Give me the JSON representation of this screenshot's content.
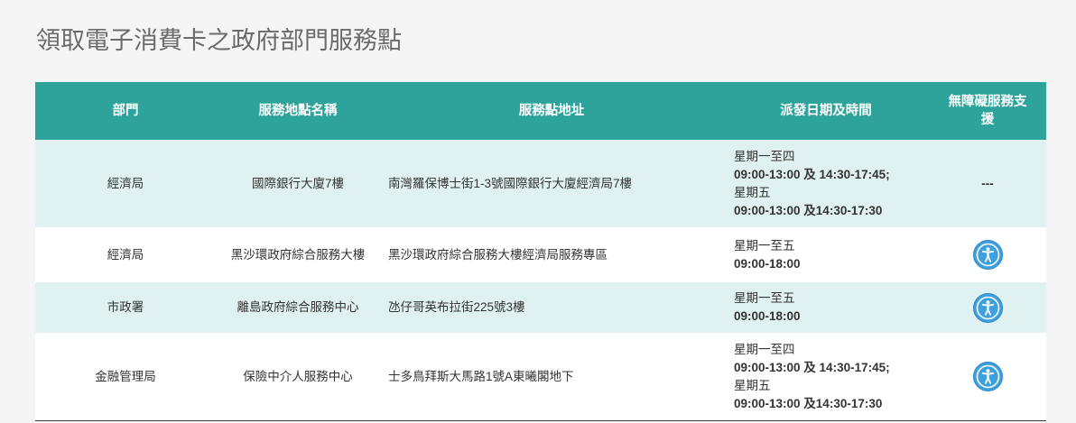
{
  "page": {
    "title": "領取電子消費卡之政府部門服務點"
  },
  "colors": {
    "page_bg": "#f5f5f5",
    "header_bg": "#2ea39c",
    "header_text": "#ffffff",
    "alt_row_bg": "#e0f1f1",
    "row_bg": "#ffffff",
    "title_text": "#6b6b6b",
    "body_text": "#333333",
    "accessibility_icon": "#3fa0de"
  },
  "table": {
    "headers": {
      "department": "部門",
      "location": "服務地點名稱",
      "address": "服務點地址",
      "schedule": "派發日期及時間",
      "accessibility": "無障礙服務支援"
    },
    "rows": [
      {
        "department": "經濟局",
        "location": "國際銀行大廈7樓",
        "address": "南灣羅保博士街1-3號國際銀行大廈經濟局7樓",
        "schedule": [
          {
            "days": "星期一至四",
            "hours": "09:00-13:00 及 14:30-17:45;"
          },
          {
            "days": "星期五",
            "hours": "09:00-13:00 及14:30-17:30"
          }
        ],
        "accessibility": {
          "text": "---"
        }
      },
      {
        "department": "經濟局",
        "location": "黑沙環政府綜合服務大樓",
        "address": "黑沙環政府綜合服務大樓經濟局服務專區",
        "schedule": [
          {
            "days": "星期一至五",
            "hours": "09:00-18:00"
          }
        ],
        "accessibility": {
          "icon": "accessibility-icon"
        }
      },
      {
        "department": "市政署",
        "location": "離島政府綜合服務中心",
        "address": "氹仔哥英布拉街225號3樓",
        "schedule": [
          {
            "days": "星期一至五",
            "hours": "09:00-18:00"
          }
        ],
        "accessibility": {
          "icon": "accessibility-icon"
        }
      },
      {
        "department": "金融管理局",
        "location": "保險中介人服務中心",
        "address": "士多鳥拜斯大馬路1號A東曦閣地下",
        "schedule": [
          {
            "days": "星期一至四",
            "hours": "09:00-13:00 及 14:30-17:45;"
          },
          {
            "days": "星期五",
            "hours": "09:00-13:00 及14:30-17:30"
          }
        ],
        "accessibility": {
          "icon": "accessibility-icon"
        }
      }
    ]
  }
}
